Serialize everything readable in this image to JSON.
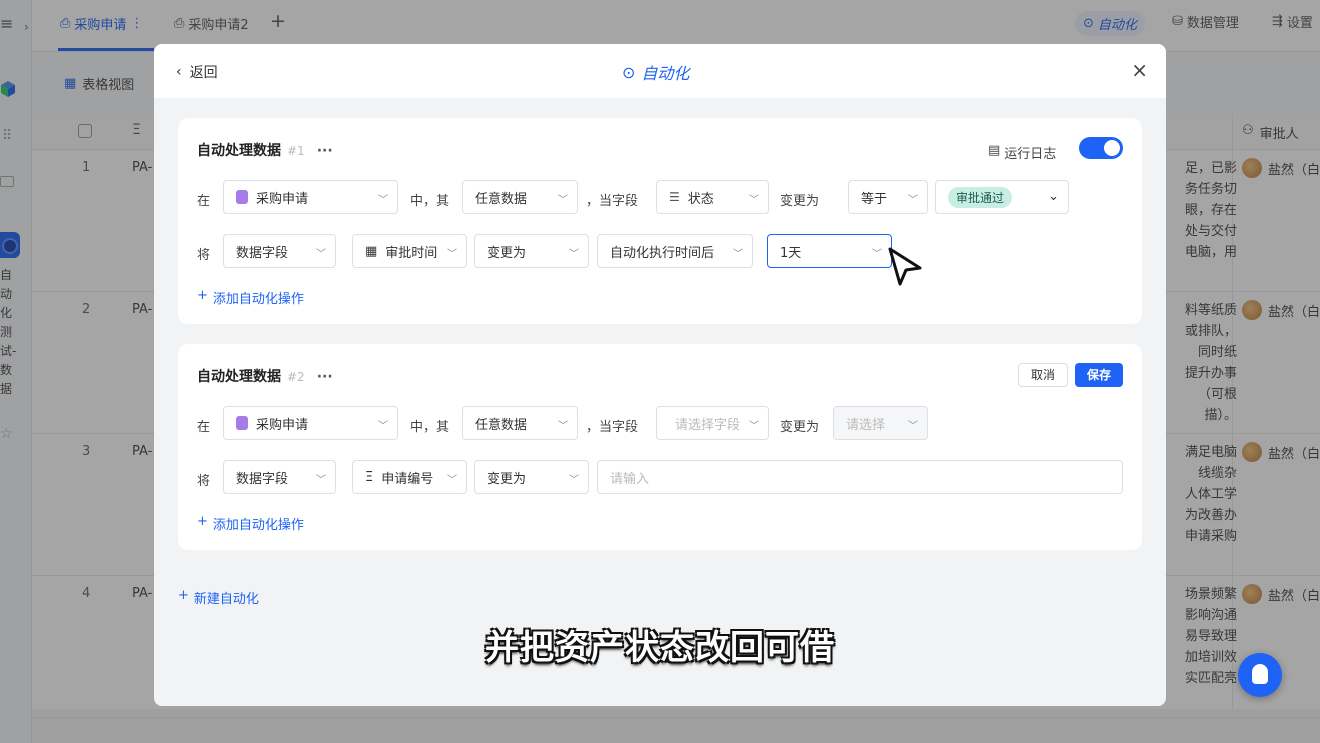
{
  "leftbar": {
    "menu_icon": "≡",
    "expand_icon": "›",
    "vertical_label": "自动化测试-数据"
  },
  "tabs": [
    {
      "label": "采购申请",
      "icon": "form-icon",
      "more": "⋮"
    },
    {
      "label": "采购申请2",
      "icon": "form-icon"
    }
  ],
  "tab_add": "+",
  "top_right": {
    "automation": "自动化",
    "data_manage": "数据管理",
    "settings": "设置"
  },
  "view": {
    "label": "表格视图"
  },
  "grid": {
    "approver_header": "审批人",
    "rows": [
      {
        "num": "1",
        "code": "PA-",
        "desc": "足，已影\n务任务切\n眼，存在\n处与交付\n电脑，用",
        "approver": "盐然（白"
      },
      {
        "num": "2",
        "code": "PA-",
        "desc": "料等纸质\n或排队，\n同时纸\n提升办事\n（可根\n描）。",
        "approver": "盐然（白"
      },
      {
        "num": "3",
        "code": "PA-",
        "desc": "满足电脑\n线缆杂\n人体工学\n为改善办\n申请采购",
        "approver": "盐然（白"
      },
      {
        "num": "4",
        "code": "PA-",
        "desc": "场景频繁\n影响沟通\n易导致理\n加培训效\n实匹配亮",
        "approver": "盐然（白"
      }
    ]
  },
  "modal": {
    "back_label": "返回",
    "title": "自动化",
    "close": "×",
    "automations": [
      {
        "title": "自动处理数据",
        "no": "#1",
        "more": "···",
        "log_label": "运行日志",
        "enabled": true,
        "cond": {
          "in_label": "在",
          "table": "采购申请",
          "mid": "中，其",
          "scope": "任意数据",
          "field_label": "，当字段",
          "field": "状态",
          "change_label": "变更为",
          "op": "等于",
          "value": "审批通过"
        },
        "action": {
          "label": "将",
          "type": "数据字段",
          "field": "审批时间",
          "verb": "变更为",
          "mode": "自动化执行时间后",
          "value": "1天"
        },
        "add_label": "添加自动化操作"
      },
      {
        "title": "自动处理数据",
        "no": "#2",
        "more": "···",
        "cancel_label": "取消",
        "save_label": "保存",
        "cond": {
          "in_label": "在",
          "table": "采购申请",
          "mid": "中，其",
          "scope": "任意数据",
          "field_label": "，当字段",
          "field_placeholder": "请选择字段",
          "change_label": "变更为",
          "op_placeholder": "请选择"
        },
        "action": {
          "label": "将",
          "type": "数据字段",
          "field": "申请编号",
          "verb": "变更为",
          "value_placeholder": "请输入"
        },
        "add_label": "添加自动化操作"
      }
    ],
    "new_label": "新建自动化"
  },
  "caption": "并把资产状态改回可借",
  "colors": {
    "accent": "#1e63f5",
    "tag_bg": "#c8eee3"
  }
}
